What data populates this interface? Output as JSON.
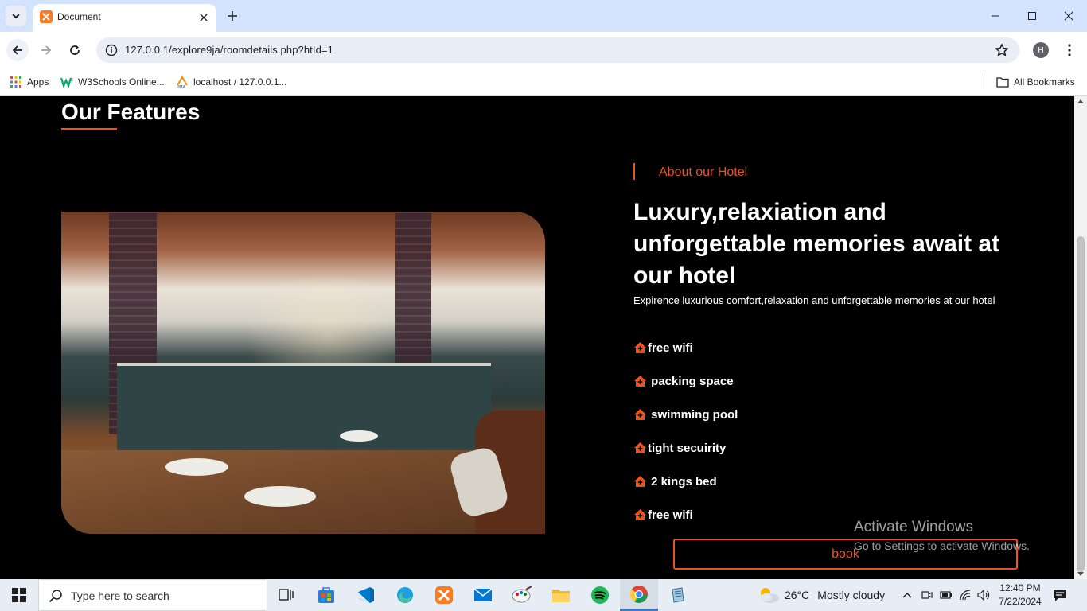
{
  "browser": {
    "tab_title": "Document",
    "url": "127.0.0.1/explore9ja/roomdetails.php?htId=1",
    "profile_initial": "H",
    "bookmarks": [
      {
        "label": "Apps",
        "icon": "apps-grid-icon"
      },
      {
        "label": "W3Schools Online...",
        "icon": "w3schools-icon"
      },
      {
        "label": "localhost / 127.0.0.1...",
        "icon": "phpmyadmin-icon"
      }
    ],
    "all_bookmarks_label": "All Bookmarks"
  },
  "page": {
    "section_title": "Our Features",
    "about_label": "About our Hotel",
    "headline": "Luxury,relaxiation and unforgettable memories await at our hotel",
    "description": "Expirence luxurious comfort,relaxation and unforgettable memories at our hotel",
    "features": [
      "free wifi",
      " packing space",
      " swimming pool",
      "tight secuirity",
      " 2 kings bed",
      "free wifi"
    ],
    "book_label": "book",
    "accent_color": "#e8541e",
    "background_color": "#000000"
  },
  "watermark": {
    "line1": "Activate Windows",
    "line2": "Go to Settings to activate Windows."
  },
  "taskbar": {
    "search_placeholder": "Type here to search",
    "apps": [
      "task-view",
      "microsoft-store",
      "vscode",
      "edge",
      "xampp",
      "mail",
      "paint",
      "file-explorer",
      "spotify",
      "chrome",
      "notepad"
    ],
    "weather_temp": "26°C",
    "weather_desc": "Mostly cloudy",
    "time": "12:40 PM",
    "date": "7/22/2024"
  }
}
